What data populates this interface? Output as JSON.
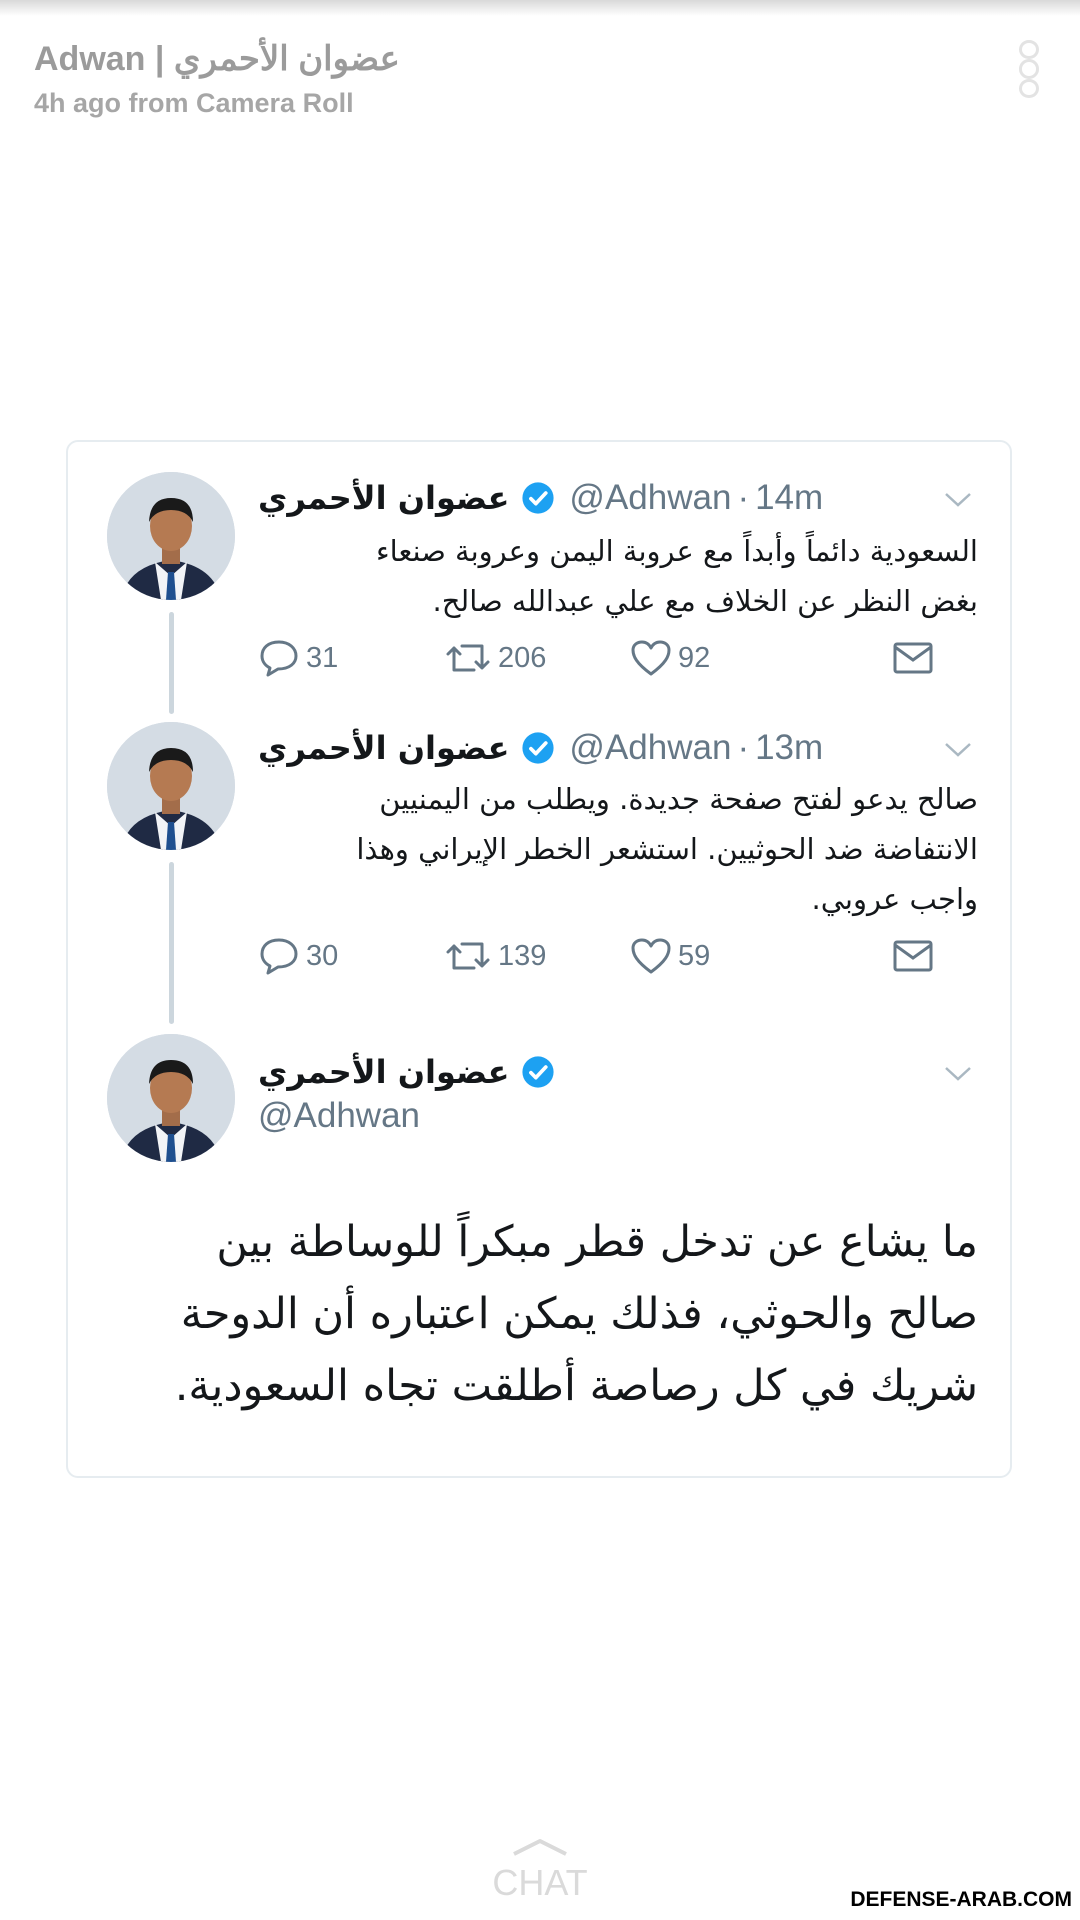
{
  "story": {
    "title": "Adwan | عضوان الأحمري",
    "subtitle": "4h ago from Camera Roll"
  },
  "tweets": [
    {
      "name": "عضوان الأحمري",
      "handle": "@Adhwan",
      "separator": "·",
      "time": "14m",
      "lines": [
        "السعودية دائماً وأبداً مع عروبة اليمن وعروبة صنعاء",
        "بغض النظر عن الخلاف مع علي عبدالله صالح."
      ],
      "replies": "31",
      "retweets": "206",
      "likes": "92"
    },
    {
      "name": "عضوان الأحمري",
      "handle": "@Adhwan",
      "separator": "·",
      "time": "13m",
      "lines": [
        "صالح يدعو لفتح صفحة جديدة. ويطلب من اليمنيين",
        "الانتفاضة ضد الحوثيين. استشعر الخطر الإيراني وهذا",
        "واجب عروبي."
      ],
      "replies": "30",
      "retweets": "139",
      "likes": "59"
    },
    {
      "name": "عضوان الأحمري",
      "handle": "@Adhwan",
      "lines": [
        "ما يشاع عن تدخل قطر مبكراً للوساطة بين",
        "صالح والحوثي، فذلك يمكن اعتباره أن الدوحة",
        "شريك في كل رصاصة أطلقت تجاه السعودية."
      ]
    }
  ],
  "footer": {
    "chat_label": "CHAT",
    "watermark": "DEFENSE-ARAB.COM"
  },
  "icons": {
    "verified": "verified-badge-icon",
    "reply": "reply-bubble-icon",
    "retweet": "retweet-icon",
    "like": "heart-icon",
    "dm": "envelope-icon",
    "chevron": "chevron-down-icon",
    "more": "more-dots-icon"
  },
  "colors": {
    "verified": "#1da1f2",
    "secondary_text": "#657786",
    "thread_line": "#ccd6dd",
    "card_border": "#e6ecf0",
    "header_text": "#9b9b9b"
  }
}
